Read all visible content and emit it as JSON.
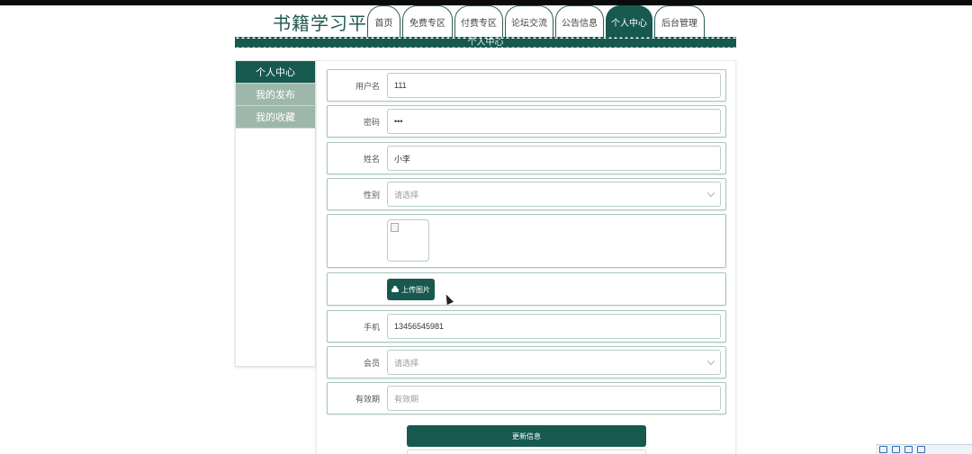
{
  "header": {
    "site_title": "书籍学习平台",
    "nav": [
      {
        "label": "首页",
        "active": false
      },
      {
        "label": "免费专区",
        "active": false
      },
      {
        "label": "付费专区",
        "active": false
      },
      {
        "label": "论坛交流",
        "active": false
      },
      {
        "label": "公告信息",
        "active": false
      },
      {
        "label": "个人中心",
        "active": true
      },
      {
        "label": "后台管理",
        "active": false
      }
    ],
    "banner_title": "个人中心"
  },
  "sidebar": {
    "items": [
      {
        "label": "个人中心",
        "active": true
      },
      {
        "label": "我的发布",
        "active": false
      },
      {
        "label": "我的收藏",
        "active": false
      }
    ]
  },
  "form": {
    "username": {
      "label": "用户名",
      "value": "111"
    },
    "password": {
      "label": "密码",
      "value": "•••"
    },
    "name": {
      "label": "姓名",
      "value": "小李"
    },
    "gender": {
      "label": "性别",
      "value": "请选择"
    },
    "avatar": {
      "upload_label": "上传图片",
      "icon": "cloud-upload-icon"
    },
    "phone": {
      "label": "手机",
      "value": "13456545981"
    },
    "member": {
      "label": "会员",
      "value": "请选择"
    },
    "validity": {
      "label": "有效期",
      "placeholder": "有效期"
    },
    "submit_label": "更新信息"
  },
  "colors": {
    "primary": "#17594f",
    "sidebar_inactive": "#9eb7ab",
    "row_border": "#a8c4bd"
  }
}
